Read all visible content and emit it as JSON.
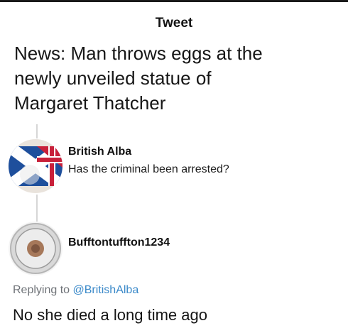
{
  "header": {
    "title": "Tweet"
  },
  "tweet": {
    "text_lines": [
      "News: Man throws eggs at the",
      "newly unveiled statue of",
      "Margaret Thatcher"
    ]
  },
  "reply1": {
    "name": "British Alba",
    "text": "Has the criminal been arrested?",
    "avatar_icon": "union-saltire-flag-avatar"
  },
  "reply2": {
    "name": "Bufftontuffton1234",
    "avatar_icon": "coin-plate-avatar",
    "replying_prefix": "Replying to",
    "replying_handle": "@BritishAlba",
    "text": "No she died a long time ago"
  },
  "colors": {
    "link": "#3a89c9",
    "muted": "#6f7378",
    "thread_line": "#d6d6d6"
  }
}
